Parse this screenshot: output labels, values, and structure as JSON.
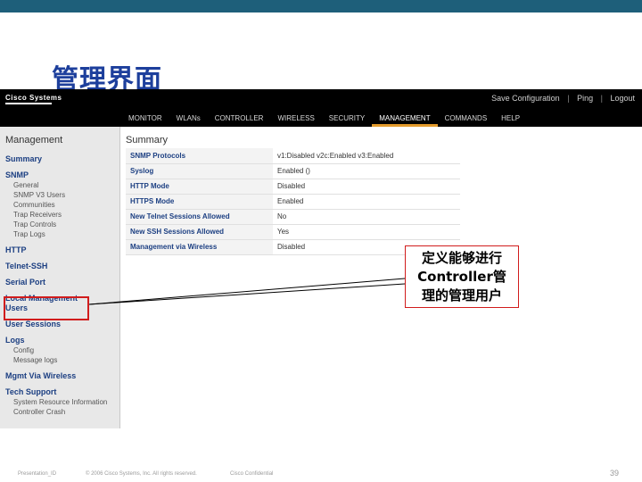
{
  "slide": {
    "title": "管理界面"
  },
  "app": {
    "logo": "Cisco Systems",
    "header_links": [
      "Save Configuration",
      "Ping",
      "Logout"
    ],
    "nav": [
      "MONITOR",
      "WLANs",
      "CONTROLLER",
      "WIRELESS",
      "SECURITY",
      "MANAGEMENT",
      "COMMANDS",
      "HELP"
    ],
    "active_nav": "MANAGEMENT",
    "sidebar": {
      "title": "Management",
      "items": [
        {
          "label": "Summary",
          "subitems": []
        },
        {
          "label": "SNMP",
          "subitems": [
            "General",
            "SNMP V3 Users",
            "Communities",
            "Trap Receivers",
            "Trap Controls",
            "Trap Logs"
          ]
        },
        {
          "label": "HTTP",
          "subitems": []
        },
        {
          "label": "Telnet-SSH",
          "subitems": []
        },
        {
          "label": "Serial Port",
          "subitems": []
        },
        {
          "label": "Local Management Users",
          "subitems": []
        },
        {
          "label": "User Sessions",
          "subitems": []
        },
        {
          "label": "Logs",
          "subitems": [
            "Config",
            "Message logs"
          ]
        },
        {
          "label": "Mgmt Via Wireless",
          "subitems": []
        },
        {
          "label": "Tech Support",
          "subitems": [
            "System Resource Information",
            "Controller Crash"
          ]
        }
      ]
    },
    "content": {
      "title": "Summary",
      "rows": [
        {
          "key": "SNMP Protocols",
          "value": "v1:Disabled  v2c:Enabled  v3:Enabled"
        },
        {
          "key": "Syslog",
          "value": "Enabled ()"
        },
        {
          "key": "HTTP Mode",
          "value": "Disabled"
        },
        {
          "key": "HTTPS Mode",
          "value": "Enabled"
        },
        {
          "key": "New Telnet Sessions Allowed",
          "value": "No"
        },
        {
          "key": "New SSH Sessions Allowed",
          "value": "Yes"
        },
        {
          "key": "Management via Wireless",
          "value": "Disabled"
        }
      ]
    }
  },
  "callout": {
    "lines": [
      "定义能够进行",
      "Controller管",
      "理的管理用户"
    ]
  },
  "footer": {
    "presentation": "Presentation_ID",
    "copyright": "© 2006 Cisco Systems, Inc. All rights reserved.",
    "confidential": "Cisco Confidential",
    "page": "39"
  },
  "colors": {
    "top_band": "#1e5f7a",
    "title": "#1d3f9c",
    "highlight": "#d11c1c",
    "active_tab_underline": "#e39b2c"
  }
}
